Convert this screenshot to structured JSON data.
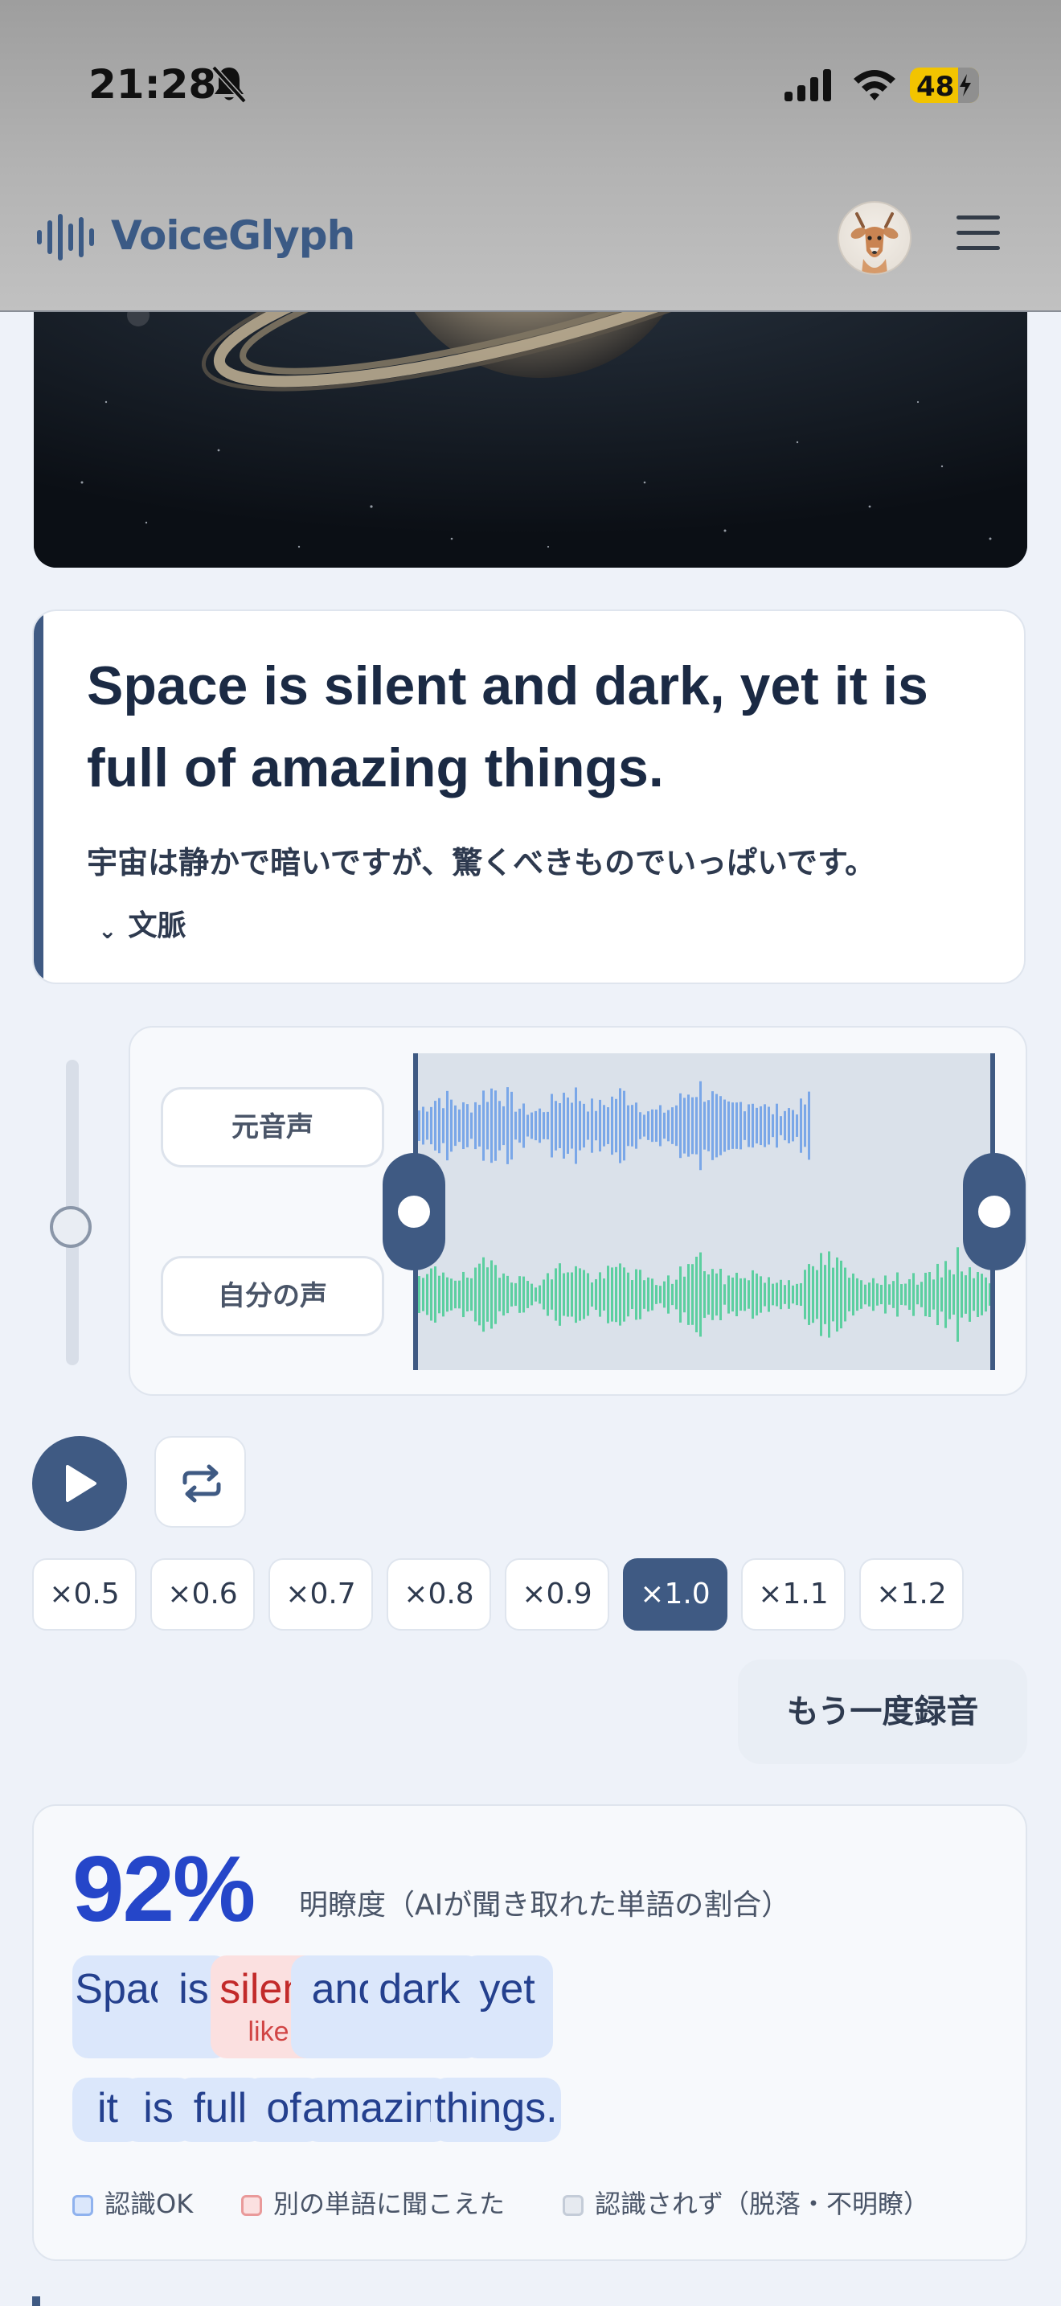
{
  "status_bar": {
    "time": "21:28",
    "battery": "48"
  },
  "header": {
    "app_name": "VoiceGlyph"
  },
  "sentence": {
    "english": "Space is silent and dark, yet it is full of amazing things.",
    "japanese": "宇宙は静かで暗いですが、驚くべきものでいっぱいです。",
    "context_label": "文脈"
  },
  "tracks": {
    "original_label": "元音声",
    "mine_label": "自分の声"
  },
  "speeds": [
    "×0.5",
    "×0.6",
    "×0.7",
    "×0.8",
    "×0.9",
    "×1.0",
    "×1.1",
    "×1.2"
  ],
  "selected_speed": "×1.0",
  "rerecord_label": "もう一度録音",
  "result": {
    "score": "92%",
    "score_label": "明瞭度（AIが聞き取れた単語の割合）",
    "words": [
      {
        "text": "Space",
        "status": "ok"
      },
      {
        "text": "is",
        "status": "ok"
      },
      {
        "text": "silent",
        "status": "wrong",
        "heard": "like"
      },
      {
        "text": "and",
        "status": "ok"
      },
      {
        "text": "dark,",
        "status": "ok"
      },
      {
        "text": "yet",
        "status": "ok"
      },
      {
        "text": "it",
        "status": "ok"
      },
      {
        "text": "is",
        "status": "ok"
      },
      {
        "text": "full",
        "status": "ok"
      },
      {
        "text": "of",
        "status": "ok"
      },
      {
        "text": "amazing",
        "status": "ok"
      },
      {
        "text": "things.",
        "status": "ok"
      }
    ],
    "legend": {
      "ok": "認識OK",
      "wrong": "別の単語に聞こえた",
      "missing": "認識されず（脱落・不明瞭）"
    }
  },
  "colors": {
    "accent": "#3f5a83",
    "score": "#2546c9",
    "chip_ok": "#dbe7fb",
    "chip_wrong": "#fbe0e0",
    "wave_original": "#7aa7e8",
    "wave_mine": "#5ccfa0"
  },
  "icons": [
    "bell-slash-icon",
    "signal-icon",
    "wifi-icon",
    "battery-icon",
    "waveform-logo-icon",
    "hamburger-menu-icon",
    "play-icon",
    "repeat-icon",
    "chevron-down-icon"
  ]
}
